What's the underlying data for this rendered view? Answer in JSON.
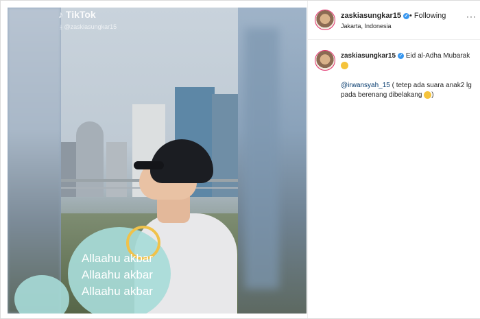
{
  "tiktok": {
    "logo": "TikTok",
    "handle": "@zaskiasungkar15"
  },
  "video": {
    "overlay_lines": [
      "Allaahu akbar",
      "Allaahu akbar",
      "Allaahu akbar"
    ]
  },
  "header": {
    "username": "zaskiasungkar15",
    "follow_status": "• Following",
    "location": "Jakarta, Indonesia",
    "more": "···"
  },
  "caption": {
    "username": "zaskiasungkar15",
    "text": "Eid al-Adha Mubarak"
  },
  "comment": {
    "mention": "@irwansyah_15",
    "text": "( tetep ada suara anak2 lg pada berenang dibelakang",
    "close": ")"
  },
  "icons": {
    "verified": "verified-badge-icon",
    "emoji": "emoji-icon",
    "more": "more-options-icon"
  },
  "colors": {
    "link": "#00376b",
    "verified": "#3897f0",
    "bubble": "#a7dbd8"
  }
}
